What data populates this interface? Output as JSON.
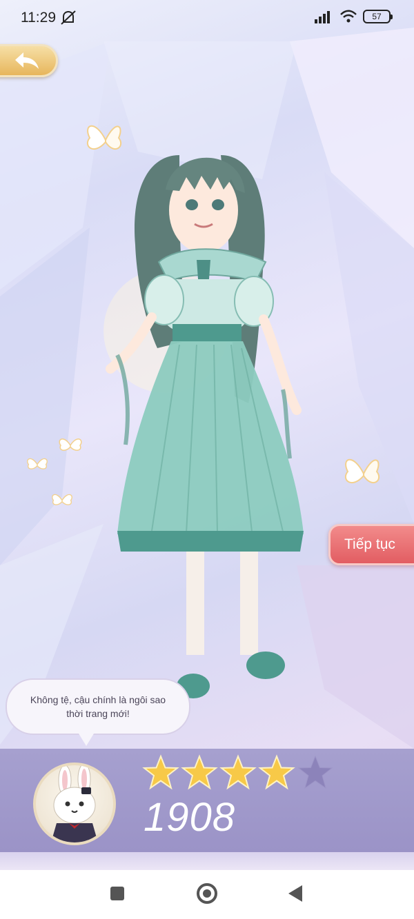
{
  "status_bar": {
    "time": "11:29",
    "battery": "57",
    "icons": [
      "mute-icon",
      "signal-icon",
      "wifi-icon",
      "battery-icon"
    ]
  },
  "top": {
    "back_icon": "back-arrow-icon"
  },
  "actions": {
    "continue_label": "Tiếp tục"
  },
  "dialog": {
    "message": "Không tệ, cậu chính là ngôi sao thời trang mới!"
  },
  "result": {
    "stars_filled": 4,
    "stars_total": 5,
    "score": "1908"
  },
  "colors": {
    "accent_gold": "#e7b65c",
    "continue_red": "#e25d62",
    "panel_purple": "#a6a0cf",
    "dress_teal": "#7fbfb3"
  },
  "nav": {
    "icons": [
      "recent-apps-icon",
      "home-icon",
      "nav-back-icon"
    ]
  }
}
